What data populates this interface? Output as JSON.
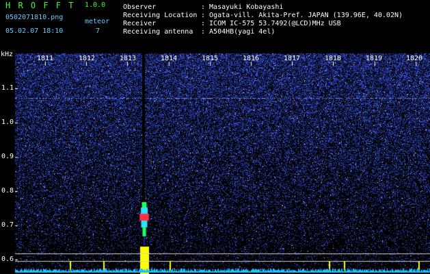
{
  "header": {
    "app_name": "H R O F F T",
    "version": "1.0.0",
    "filename": "0502071810.png",
    "datetime": "05.02.07 18:10",
    "meteor_label": "meteor",
    "meteor_count": "7"
  },
  "info": {
    "observer_label": "Observer",
    "observer_value": ": Masayuki Kobayashi",
    "location_label": "Receiving Location",
    "location_value": ": Ogata-vill. Akita-Pref. JAPAN (139.96E, 40.02N)",
    "receiver_label": "Receiver",
    "receiver_value": ": ICOM IC-575 53.7492(@LCD)MHz USB",
    "antenna_label": "Receiving antenna",
    "antenna_value": ": A504HB(yagi 4el)"
  },
  "chart_data": {
    "type": "heatmap",
    "ylabel": "kHz",
    "x_ticks": [
      "1811",
      "1812",
      "1813",
      "1814",
      "1815",
      "1816",
      "1817",
      "1818",
      "1819",
      "1820"
    ],
    "y_ticks": [
      "1.1",
      "1.0",
      "0.9",
      "0.8",
      "0.7",
      "0.6"
    ],
    "meteor_echo": {
      "time": "1813.5",
      "freq_center_khz": 0.72
    },
    "colors": {
      "background": "#000000",
      "noise": "#1a2a8c",
      "tick_text": "#ffffff",
      "signal_yellow": "#ffff00",
      "signal_red": "#ff2030",
      "signal_green": "#20ff60",
      "baseline": "#20c0ff"
    }
  }
}
